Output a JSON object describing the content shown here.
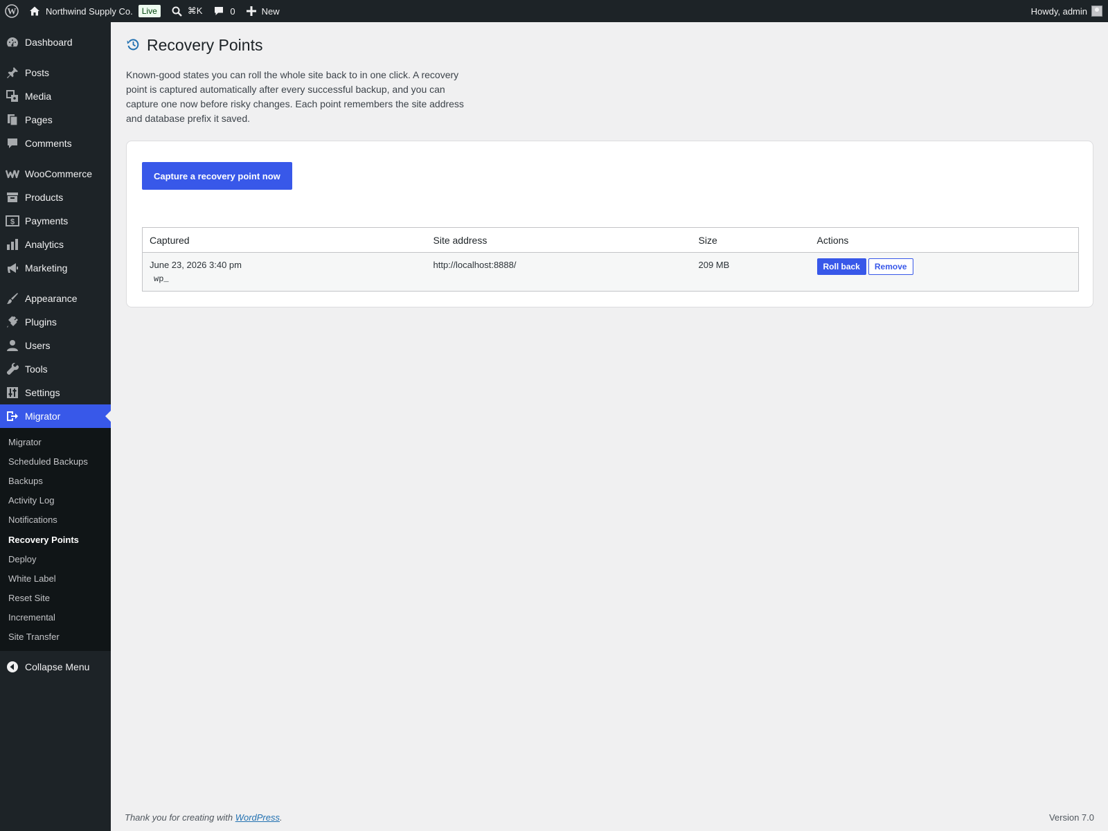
{
  "adminbar": {
    "site_name": "Northwind Supply Co.",
    "live_badge": "Live",
    "search_shortcut": "⌘K",
    "comments_count": "0",
    "new_label": "New",
    "howdy": "Howdy, admin"
  },
  "sidebar": {
    "items": [
      {
        "label": "Dashboard",
        "icon": "dashboard-icon"
      },
      {
        "label": "Posts",
        "icon": "pin-icon"
      },
      {
        "label": "Media",
        "icon": "media-icon"
      },
      {
        "label": "Pages",
        "icon": "pages-icon"
      },
      {
        "label": "Comments",
        "icon": "comment-icon"
      },
      {
        "label": "WooCommerce",
        "icon": "woo-icon"
      },
      {
        "label": "Products",
        "icon": "archive-icon"
      },
      {
        "label": "Payments",
        "icon": "dollar-icon"
      },
      {
        "label": "Analytics",
        "icon": "bar-chart-icon"
      },
      {
        "label": "Marketing",
        "icon": "megaphone-icon"
      },
      {
        "label": "Appearance",
        "icon": "brush-icon"
      },
      {
        "label": "Plugins",
        "icon": "plug-icon"
      },
      {
        "label": "Users",
        "icon": "user-icon"
      },
      {
        "label": "Tools",
        "icon": "wrench-icon"
      },
      {
        "label": "Settings",
        "icon": "sliders-icon"
      },
      {
        "label": "Migrator",
        "icon": "migrate-icon"
      }
    ],
    "submenu": [
      "Migrator",
      "Scheduled Backups",
      "Backups",
      "Activity Log",
      "Notifications",
      "Recovery Points",
      "Deploy",
      "White Label",
      "Reset Site",
      "Incremental",
      "Site Transfer"
    ],
    "collapse_label": "Collapse Menu"
  },
  "page": {
    "title": "Recovery Points",
    "description": "Known-good states you can roll the whole site back to in one click. A recovery point is captured automatically after every successful backup, and you can capture one now before risky changes. Each point remembers the site address and database prefix it saved.",
    "capture_button": "Capture a recovery point now"
  },
  "table": {
    "headers": [
      "Captured",
      "Site address",
      "Size",
      "Actions"
    ],
    "rows": [
      {
        "captured": "June 23, 2026 3:40 pm",
        "prefix": "wp_",
        "site_address": "http://localhost:8888/",
        "size": "209 MB",
        "rollback_label": "Roll back",
        "remove_label": "Remove"
      }
    ]
  },
  "footer": {
    "thanks_prefix": "Thank you for creating with ",
    "wordpress_link": "WordPress",
    "thanks_suffix": ".",
    "version": "Version 7.0"
  },
  "colors": {
    "accent": "#3858e9",
    "adminbar_bg": "#1d2327",
    "background": "#f0f0f1"
  }
}
